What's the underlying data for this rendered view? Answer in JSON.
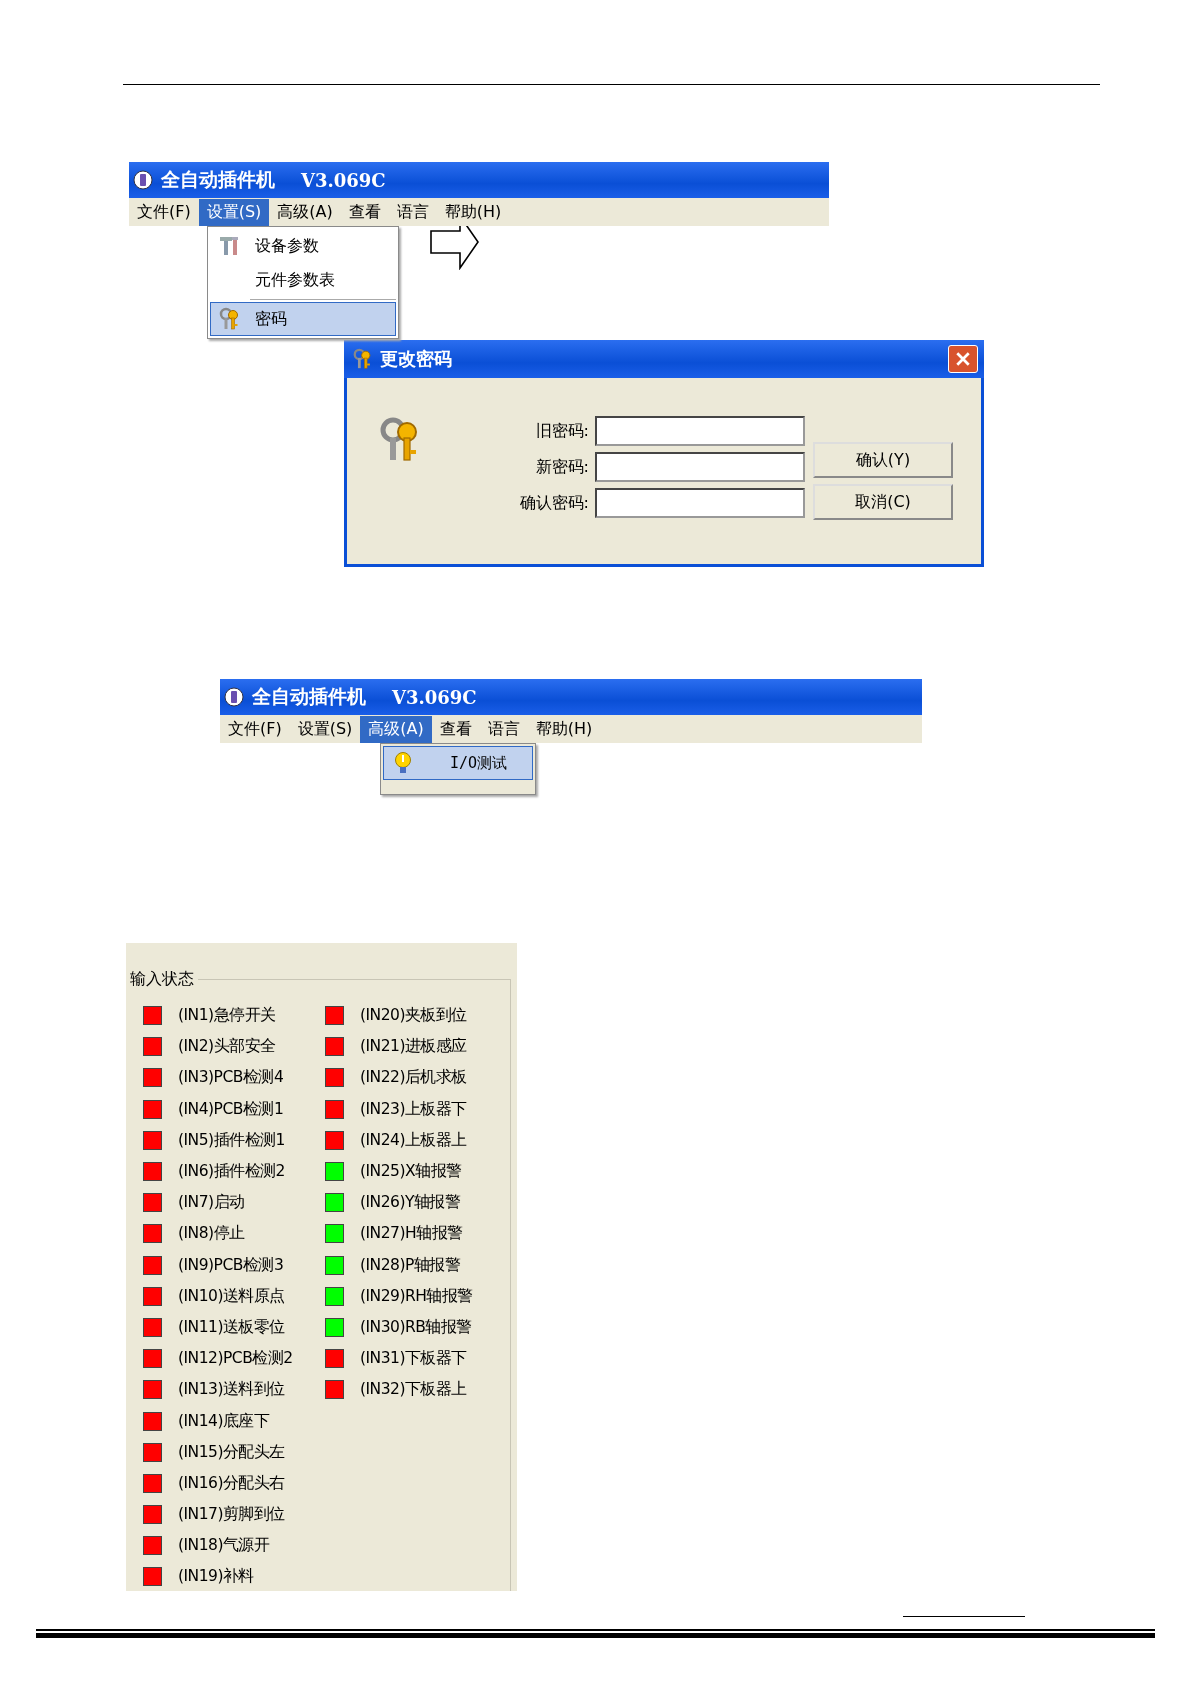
{
  "windows": [
    {
      "title": "全自动插件机",
      "version": "V3.069C",
      "menu": [
        {
          "label": "文件(F)",
          "selected": false
        },
        {
          "label": "设置(S)",
          "selected": true
        },
        {
          "label": "高级(A)",
          "selected": false
        },
        {
          "label": "查看",
          "selected": false
        },
        {
          "label": "语言",
          "selected": false
        },
        {
          "label": "帮助(H)",
          "selected": false
        }
      ],
      "dropdown": [
        {
          "label": "设备参数",
          "selected": false
        },
        {
          "label": "元件参数表",
          "selected": false
        },
        {
          "label": "密码",
          "selected": true
        }
      ]
    },
    {
      "title": "全自动插件机",
      "version": "V3.069C",
      "menu": [
        {
          "label": "文件(F)",
          "selected": false
        },
        {
          "label": "设置(S)",
          "selected": false
        },
        {
          "label": "高级(A)",
          "selected": true
        },
        {
          "label": "查看",
          "selected": false
        },
        {
          "label": "语言",
          "selected": false
        },
        {
          "label": "帮助(H)",
          "selected": false
        }
      ],
      "dropdown": [
        {
          "label": "I/O测试",
          "selected": true
        }
      ]
    }
  ],
  "dialog": {
    "title": "更改密码",
    "fields": [
      {
        "label": "旧密码:"
      },
      {
        "label": "新密码:"
      },
      {
        "label": "确认密码:"
      }
    ],
    "buttons": [
      "确认(Y)",
      "取消(C)"
    ]
  },
  "input_panel": {
    "title": "输入状态",
    "columns": [
      [
        {
          "label": "(IN1)急停开关",
          "color": "#ff0000"
        },
        {
          "label": "(IN2)头部安全",
          "color": "#ff0000"
        },
        {
          "label": "(IN3)PCB检测4",
          "color": "#ff0000"
        },
        {
          "label": "(IN4)PCB检测1",
          "color": "#ff0000"
        },
        {
          "label": "(IN5)插件检测1",
          "color": "#ff0000"
        },
        {
          "label": "(IN6)插件检测2",
          "color": "#ff0000"
        },
        {
          "label": "(IN7)启动",
          "color": "#ff0000"
        },
        {
          "label": "(IN8)停止",
          "color": "#ff0000"
        },
        {
          "label": "(IN9)PCB检测3",
          "color": "#ff0000"
        },
        {
          "label": "(IN10)送料原点",
          "color": "#ff0000"
        },
        {
          "label": "(IN11)送板零位",
          "color": "#ff0000"
        },
        {
          "label": "(IN12)PCB检测2",
          "color": "#ff0000"
        },
        {
          "label": "(IN13)送料到位",
          "color": "#ff0000"
        },
        {
          "label": "(IN14)底座下",
          "color": "#ff0000"
        },
        {
          "label": "(IN15)分配头左",
          "color": "#ff0000"
        },
        {
          "label": "(IN16)分配头右",
          "color": "#ff0000"
        },
        {
          "label": "(IN17)剪脚到位",
          "color": "#ff0000"
        },
        {
          "label": "(IN18)气源开",
          "color": "#ff0000"
        },
        {
          "label": "(IN19)补料",
          "color": "#ff0000"
        }
      ],
      [
        {
          "label": "(IN20)夹板到位",
          "color": "#ff0000"
        },
        {
          "label": "(IN21)进板感应",
          "color": "#ff0000"
        },
        {
          "label": "(IN22)后机求板",
          "color": "#ff0000"
        },
        {
          "label": "(IN23)上板器下",
          "color": "#ff0000"
        },
        {
          "label": "(IN24)上板器上",
          "color": "#ff0000"
        },
        {
          "label": "(IN25)X轴报警",
          "color": "#00ff00"
        },
        {
          "label": "(IN26)Y轴报警",
          "color": "#00ff00"
        },
        {
          "label": "(IN27)H轴报警",
          "color": "#00ff00"
        },
        {
          "label": "(IN28)P轴报警",
          "color": "#00ff00"
        },
        {
          "label": "(IN29)RH轴报警",
          "color": "#00ff00"
        },
        {
          "label": "(IN30)RB轴报警",
          "color": "#00ff00"
        },
        {
          "label": "(IN31)下板器下",
          "color": "#ff0000"
        },
        {
          "label": "(IN32)下板器上",
          "color": "#ff0000"
        }
      ]
    ]
  }
}
